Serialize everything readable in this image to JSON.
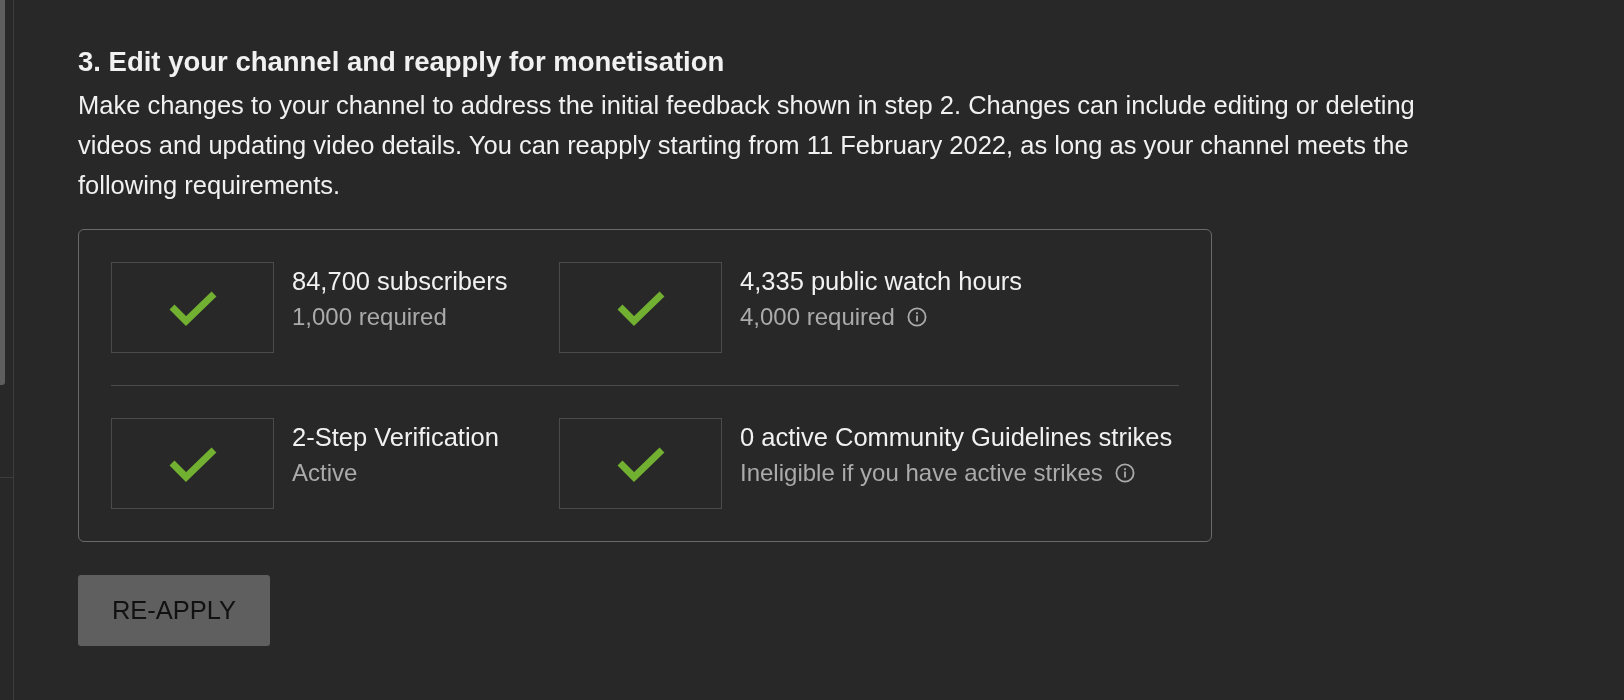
{
  "heading": "3. Edit your channel and reapply for monetisation",
  "description": "Make changes to your channel to address the initial feedback shown in step 2. Changes can include editing or deleting videos and updating video details. You can reapply starting from 11 February 2022, as long as your channel meets the following requirements.",
  "requirements": [
    {
      "title": "84,700 subscribers",
      "detail": "1,000 required",
      "met": true,
      "has_info": false
    },
    {
      "title": "4,335 public watch hours",
      "detail": "4,000 required",
      "met": true,
      "has_info": true
    },
    {
      "title": "2-Step Verification",
      "detail": "Active",
      "met": true,
      "has_info": false
    },
    {
      "title": "0 active Community Guidelines strikes",
      "detail": "Ineligible if you have active strikes",
      "met": true,
      "has_info": true
    }
  ],
  "reapply_button": {
    "label": "RE-APPLY",
    "disabled": true
  }
}
